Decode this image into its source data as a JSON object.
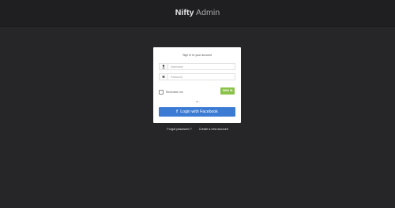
{
  "header": {
    "brand_bold": "Nifty",
    "brand_light": "Admin"
  },
  "login": {
    "title": "Sign In to your account",
    "username_placeholder": "Username",
    "password_placeholder": "Password",
    "remember_label": "Remember me",
    "signin_label": "SIGN IN",
    "or_label": "- or -",
    "facebook_label": "Login with Facebook",
    "facebook_icon_glyph": "f"
  },
  "footer_links": {
    "forgot": "Forgot password ?",
    "create": "Create a new account"
  },
  "colors": {
    "background": "#262629",
    "topbar": "#1f1f22",
    "signin_button": "#8bc34a",
    "facebook_button": "#3b7bd4"
  },
  "icons": {
    "username": "user-icon",
    "password": "asterisk-icon",
    "facebook": "facebook-icon"
  }
}
